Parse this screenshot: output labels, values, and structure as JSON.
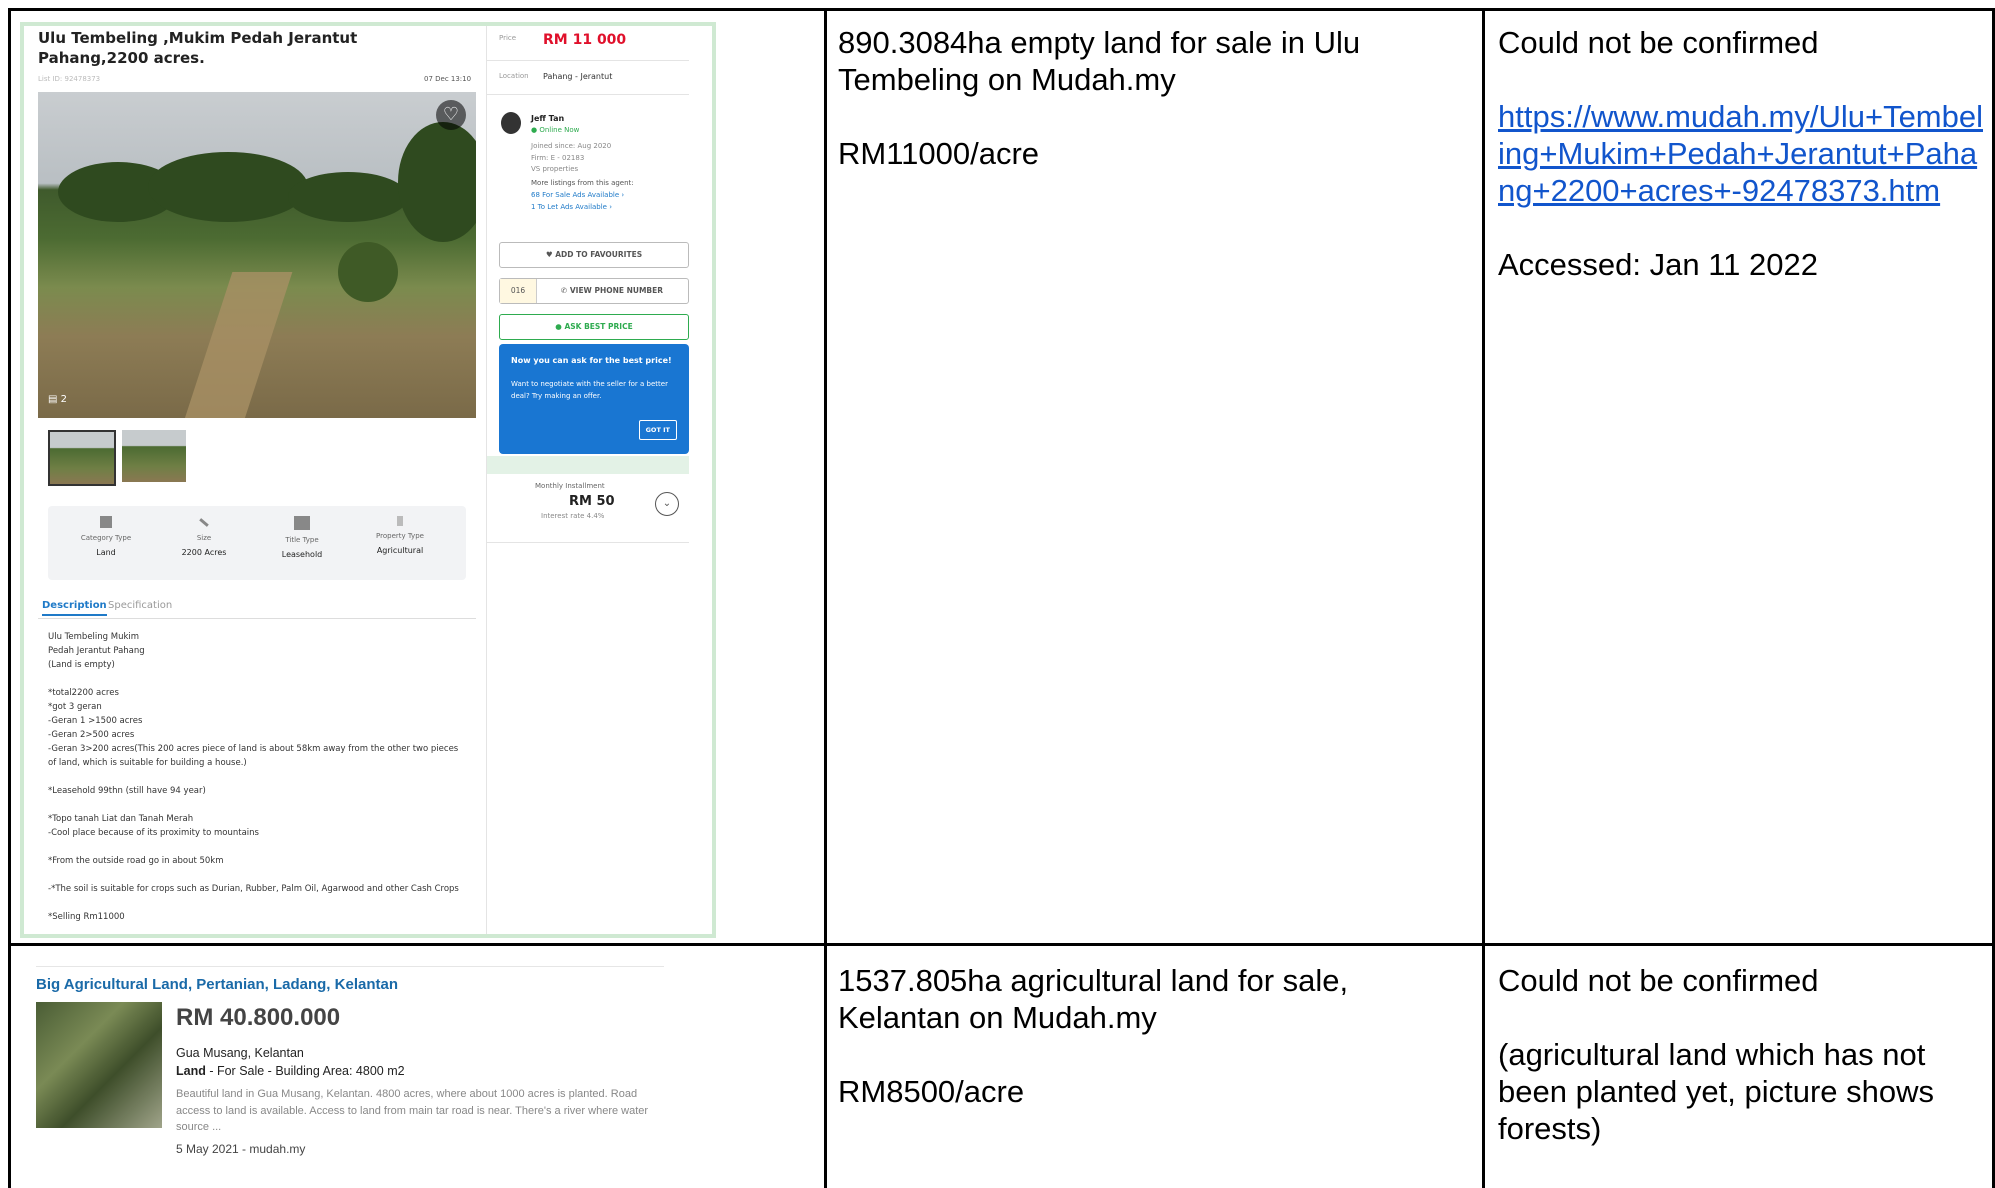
{
  "row1": {
    "col2": {
      "title": "890.3084ha empty land for sale in Ulu Tembeling on Mudah.my",
      "price": "RM11000/acre"
    },
    "col3": {
      "status": "Could not be confirmed",
      "url": "https://www.mudah.my/Ulu+Tembeling+Mukim+Pedah+Jerantut+Pahang+2200+acres+-92478373.htm",
      "accessed": "Accessed: Jan 11 2022"
    },
    "screenshot": {
      "title": "Ulu Tembeling ,Mukim Pedah Jerantut Pahang,2200 acres.",
      "list_id": "List ID: 92478373",
      "date": "07 Dec 13:10",
      "photo_count": "2",
      "attributes": [
        {
          "label": "Category Type",
          "value": "Land"
        },
        {
          "label": "Size",
          "value": "2200 Acres"
        },
        {
          "label": "Title Type",
          "value": "Leasehold"
        },
        {
          "label": "Property Type",
          "value": "Agricultural"
        }
      ],
      "tabs": [
        "Description",
        "Specification"
      ],
      "description": "Ulu Tembeling Mukim\nPedah Jerantut Pahang\n(Land is empty)\n\n*total2200 acres\n*got 3 geran\n-Geran 1 >1500 acres\n-Geran 2>500 acres\n-Geran 3>200 acres(This 200 acres piece of land is about 58km away from the other two pieces of land, which is suitable for building a house.)\n\n*Leasehold 99thn (still have 94 year)\n\n*Topo tanah Liat dan Tanah Merah\n-Cool place because of its proximity to mountains\n\n*From the outside road go in about 50km\n\n-*The soil is suitable for crops such as Durian, Rubber, Palm Oil, Agarwood and other Cash Crops\n\n*Selling Rm11000",
      "sidebar": {
        "price_label": "Price",
        "price": "RM 11 000",
        "location_label": "Location",
        "location": "Pahang - Jerantut",
        "agent_name": "Jeff Tan",
        "online": "Online Now",
        "joined": "Joined since: Aug 2020",
        "firm": "Firm: E - 02183",
        "company": "VS properties",
        "more": "More listings from this agent:",
        "sale_link": "68 For Sale Ads Available",
        "let_link": "1 To Let Ads Available",
        "fav_button": "ADD TO FAVOURITES",
        "phone_prefix": "016",
        "phone_button": "VIEW PHONE NUMBER",
        "best_price_button": "ASK BEST PRICE",
        "tooltip_title": "Now you can ask for the best price!",
        "tooltip_body": "Want to negotiate with the seller for a better deal? Try making an offer.",
        "tooltip_button": "GOT IT",
        "installment_label": "Monthly Installment",
        "installment_value": "RM 50",
        "interest": "Interest rate 4.4%"
      }
    }
  },
  "row2": {
    "col2": {
      "title": "1537.805ha agricultural land for sale, Kelantan on Mudah.my",
      "price": "RM8500/acre"
    },
    "col3": {
      "status": "Could not be confirmed",
      "note": "(agricultural land which has not been planted yet, picture shows forests)"
    },
    "screenshot": {
      "title": "Big Agricultural Land, Pertanian, Ladang, Kelantan",
      "price": "RM 40.800.000",
      "location": "Gua Musang, Kelantan",
      "type_bold": "Land",
      "type_rest": " - For Sale - Building Area: 4800 m2",
      "snippet": "Beautiful land in Gua Musang, Kelantan. 4800 acres, where about 1000 acres is planted. Road access to land is available. Access to land from main tar road is near. There's a river where water source ...",
      "date": "5 May 2021 - mudah.my"
    }
  }
}
